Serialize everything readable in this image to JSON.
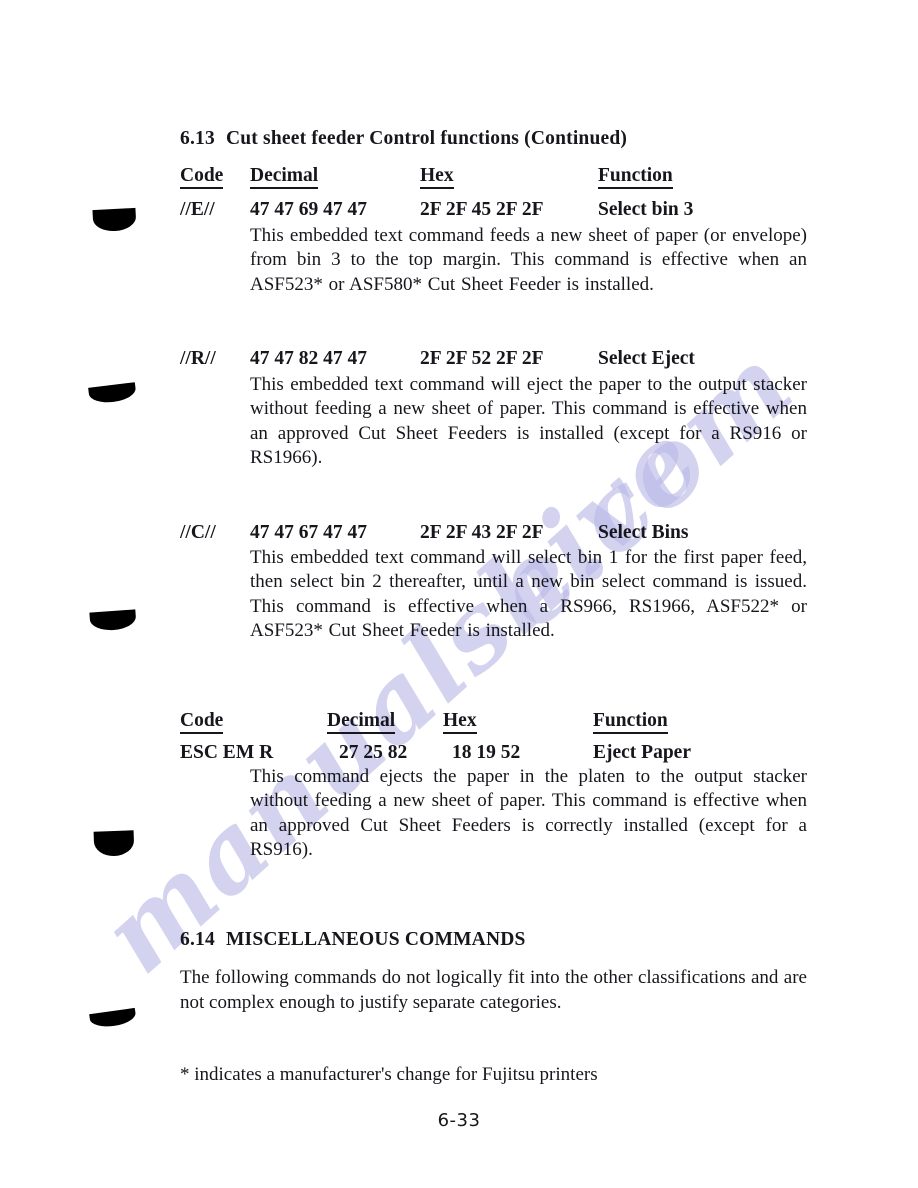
{
  "page": {
    "page_number": "6-33",
    "background_color": "#ffffff",
    "text_color": "#16161c",
    "watermark_color": "#b9b9e8"
  },
  "watermark": {
    "left_text": "manualshive",
    "right_text": "e.com"
  },
  "section_613": {
    "number": "6.13",
    "title": "Cut sheet feeder Control functions (Continued)"
  },
  "table_headers_1": {
    "code": "Code",
    "decimal": "Decimal",
    "hex": "Hex",
    "function": "Function"
  },
  "table_headers_2": {
    "code": "Code",
    "decimal": "Decimal",
    "hex": "Hex",
    "function": "Function"
  },
  "commands": [
    {
      "code": "//E//",
      "decimal": "47 47 69 47 47",
      "hex": "2F 2F 45 2F 2F",
      "function": "Select bin 3",
      "description": "This embedded text command feeds a new sheet of paper (or envelope) from bin 3 to the top margin. This command is effective when an ASF523* or ASF580* Cut Sheet Feeder is installed."
    },
    {
      "code": "//R//",
      "decimal": "47 47 82 47 47",
      "hex": "2F 2F 52 2F 2F",
      "function": "Select Eject",
      "description": "This embedded text command will eject the paper to the output stacker without feeding a new sheet of paper.  This command is effective when an approved Cut Sheet Feeders is installed (except for a RS916 or RS1966)."
    },
    {
      "code": "//C//",
      "decimal": "47 47 67 47 47",
      "hex": "2F 2F 43 2F 2F",
      "function": "Select Bins",
      "description": "This embedded text command will select bin 1 for the first paper feed, then select bin 2 thereafter, until a new bin select command is issued.  This command is effective when a RS966, RS1966, ASF522* or ASF523* Cut Sheet Feeder is installed."
    },
    {
      "code": "ESC EM R",
      "decimal": "27 25 82",
      "hex": "18 19 52",
      "function": "Eject Paper",
      "description": "This command ejects the paper in the platen to the output stacker without feeding a new  sheet of paper.  This command is effective when an approved Cut Sheet Feeders is correctly installed (except for a RS916)."
    }
  ],
  "section_614": {
    "number": "6.14",
    "title": "MISCELLANEOUS COMMANDS",
    "body": "The following commands do not logically fit into the other classifications and are not complex enough to justify separate categories."
  },
  "footnote": {
    "text": "* indicates a manufacturer's change for Fujitsu printers"
  }
}
